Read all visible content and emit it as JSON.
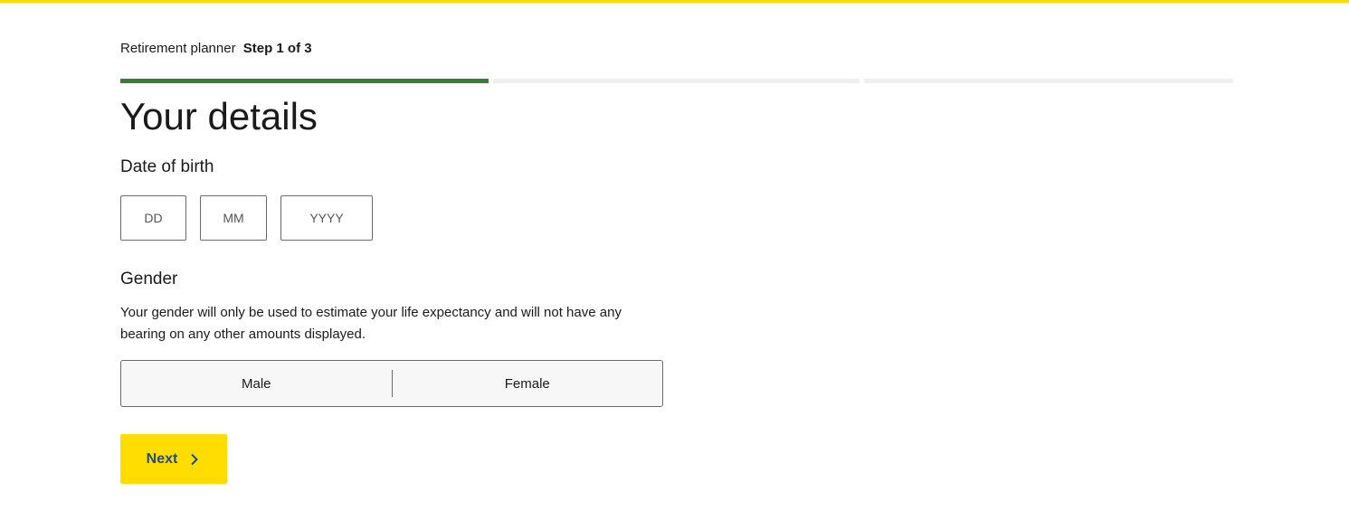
{
  "header": {
    "app_name": "Retirement planner",
    "step_text": "Step 1 of 3"
  },
  "progress": {
    "current_step": 1,
    "total_steps": 3
  },
  "page": {
    "title": "Your details"
  },
  "dob": {
    "label": "Date of birth",
    "day": {
      "value": "",
      "placeholder": "DD"
    },
    "month": {
      "value": "",
      "placeholder": "MM"
    },
    "year": {
      "value": "",
      "placeholder": "YYYY"
    }
  },
  "gender": {
    "label": "Gender",
    "hint": "Your gender will only be used to estimate your life expectancy and will not have any bearing on any other amounts displayed.",
    "options": [
      "Male",
      "Female"
    ]
  },
  "actions": {
    "next_label": "Next",
    "next_icon": "chevron-right-icon"
  },
  "colors": {
    "accent_yellow": "#FFDD00",
    "progress_green": "#3A7D34",
    "button_text_blue": "#1F4C8F"
  }
}
